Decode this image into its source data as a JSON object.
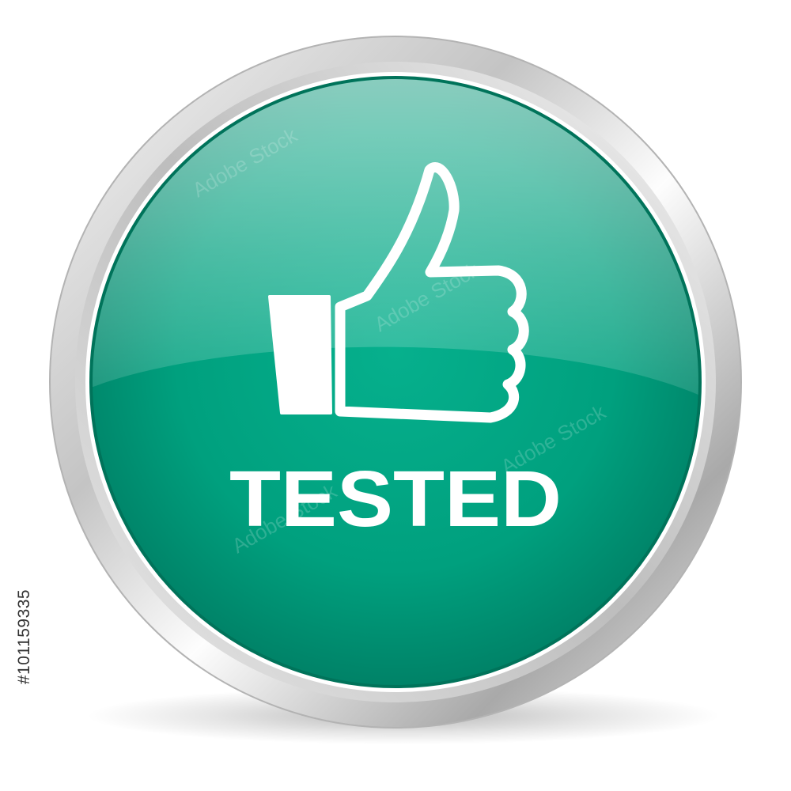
{
  "badge": {
    "label": "TESTED",
    "icon": "thumbs-up-icon",
    "colors": {
      "primary": "#00a07e",
      "dark": "#00745c",
      "highlight": "#86d6c3",
      "ring": "#cfcfcf",
      "icon": "#ffffff"
    }
  },
  "watermark": {
    "text": "Adobe Stock"
  },
  "stock_id": "#101159335"
}
